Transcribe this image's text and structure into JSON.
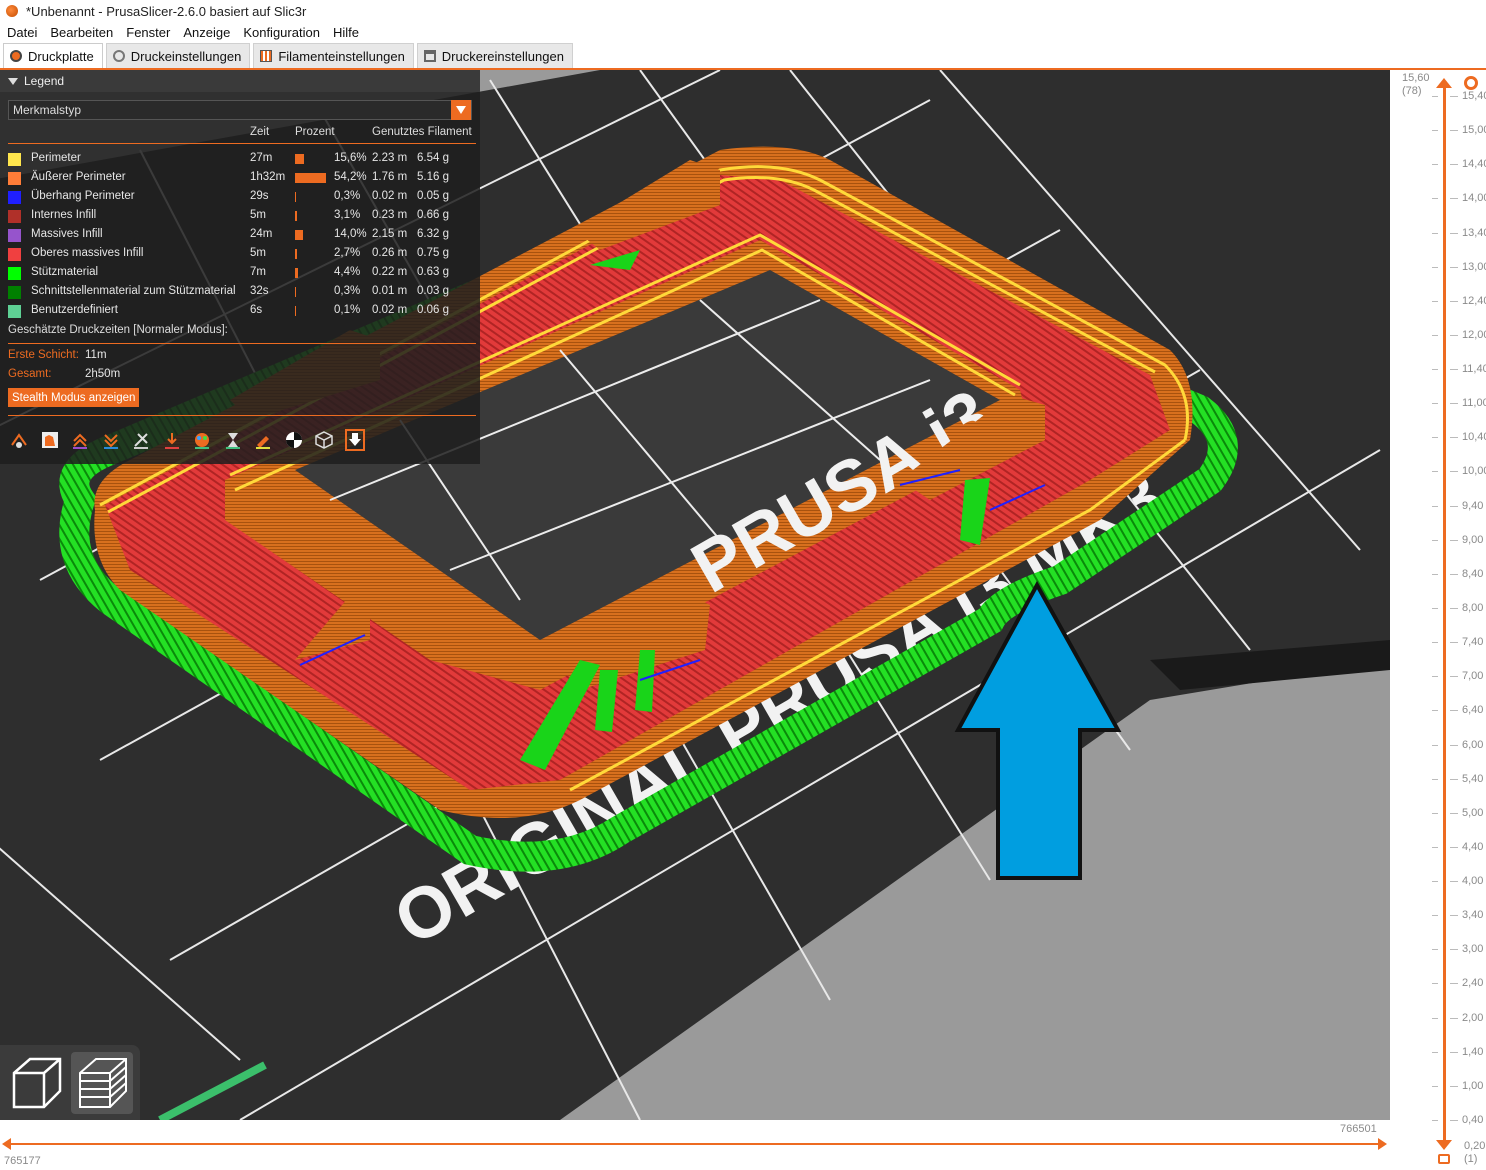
{
  "window": {
    "title": "*Unbenannt - PrusaSlicer-2.6.0 basiert auf Slic3r"
  },
  "menu": [
    "Datei",
    "Bearbeiten",
    "Fenster",
    "Anzeige",
    "Konfiguration",
    "Hilfe"
  ],
  "tabs": [
    "Druckplatte",
    "Druckeinstellungen",
    "Filamenteinstellungen",
    "Druckereinstellungen"
  ],
  "legend": {
    "title": "Legend",
    "view_type": "Merkmalstyp",
    "headers": {
      "time": "Zeit",
      "percent": "Prozent",
      "filament": "Genutztes Filament"
    },
    "rows": [
      {
        "name": "Perimeter",
        "color": "#ffe64d",
        "time": "27m",
        "share": 0.156,
        "pct": "15,6%",
        "len": "2.23 m",
        "wt": "6.54 g"
      },
      {
        "name": "Äußerer Perimeter",
        "color": "#ff7d38",
        "time": "1h32m",
        "share": 0.542,
        "pct": "54,2%",
        "len": "1.76 m",
        "wt": "5.16 g"
      },
      {
        "name": "Überhang Perimeter",
        "color": "#1f1fff",
        "time": "29s",
        "share": 0.003,
        "pct": "0,3%",
        "len": "0.02 m",
        "wt": "0.05 g"
      },
      {
        "name": "Internes Infill",
        "color": "#b03029",
        "time": "5m",
        "share": 0.031,
        "pct": "3,1%",
        "len": "0.23 m",
        "wt": "0.66 g"
      },
      {
        "name": "Massives Infill",
        "color": "#9654cc",
        "time": "24m",
        "share": 0.14,
        "pct": "14,0%",
        "len": "2.15 m",
        "wt": "6.32 g"
      },
      {
        "name": "Oberes massives Infill",
        "color": "#f04040",
        "time": "5m",
        "share": 0.027,
        "pct": "2,7%",
        "len": "0.26 m",
        "wt": "0.75 g"
      },
      {
        "name": "Stützmaterial",
        "color": "#00ff00",
        "time": "7m",
        "share": 0.044,
        "pct": "4,4%",
        "len": "0.22 m",
        "wt": "0.63 g"
      },
      {
        "name": "Schnittstellenmaterial zum Stützmaterial",
        "color": "#008000",
        "time": "32s",
        "share": 0.003,
        "pct": "0,3%",
        "len": "0.01 m",
        "wt": "0.03 g"
      },
      {
        "name": "Benutzerdefiniert",
        "color": "#5ed194",
        "time": "6s",
        "share": 0.001,
        "pct": "0,1%",
        "len": "0.02 m",
        "wt": "0.06 g"
      }
    ],
    "estimates_title": "Geschätzte Druckzeiten [Normaler Modus]:",
    "first_layer_label": "Erste Schicht:",
    "first_layer_value": "11m",
    "total_label": "Gesamt:",
    "total_value": "2h50m",
    "stealth_button": "Stealth Modus anzeigen"
  },
  "bed_text": "ORIGINAL PRUSA i3 MK3",
  "vertical_slider": {
    "top_value": "15,60",
    "top_layer": "(78)",
    "bottom_value": "0,20",
    "bottom_layer": "(1)",
    "ticks": [
      "15,40",
      "15,00",
      "14,40",
      "14,00",
      "13,40",
      "13,00",
      "12,40",
      "12,00",
      "11,40",
      "11,00",
      "10,40",
      "10,00",
      "9,40",
      "9,00",
      "8,40",
      "8,00",
      "7,40",
      "7,00",
      "6,40",
      "6,00",
      "5,40",
      "5,00",
      "4,40",
      "4,00",
      "3,40",
      "3,00",
      "2,40",
      "2,00",
      "1,40",
      "1,00",
      "0,40"
    ]
  },
  "horizontal_slider": {
    "left_value": "765177",
    "right_value": "766501"
  },
  "colors": {
    "accent": "#ed6b21",
    "arrow": "#009ee0"
  }
}
